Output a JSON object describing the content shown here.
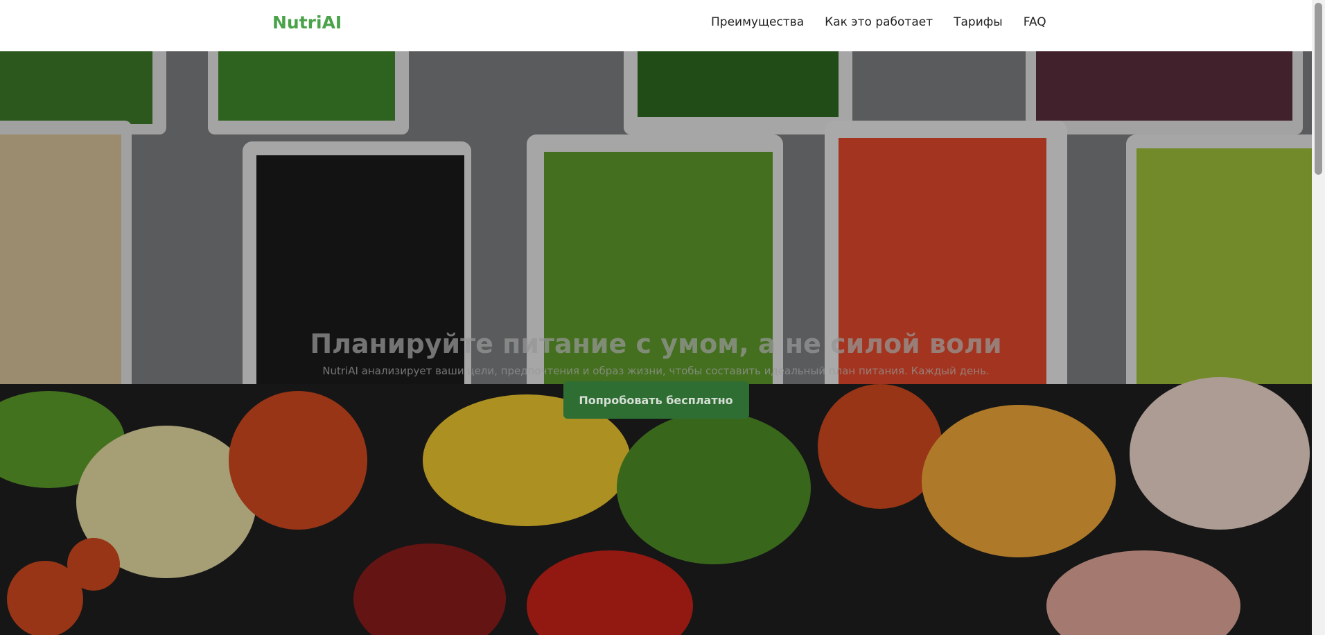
{
  "header": {
    "logo": "NutriAI",
    "nav": [
      {
        "label": "Преимущества"
      },
      {
        "label": "Как это работает"
      },
      {
        "label": "Тарифы"
      },
      {
        "label": "FAQ"
      }
    ]
  },
  "hero": {
    "title": "Планируйте питание с умом, а не силой воли",
    "subtitle": "NutriAI анализирует ваши цели, предпочтения и образ жизни, чтобы составить идеальный план питания. Каждый день.",
    "cta_label": "Попробовать бесплатно",
    "background_image": "salad-bar-vegetables-photo"
  },
  "colors": {
    "brand": "#4aa34a",
    "cta_background": "#2f6e33",
    "nav_text": "#222222"
  }
}
